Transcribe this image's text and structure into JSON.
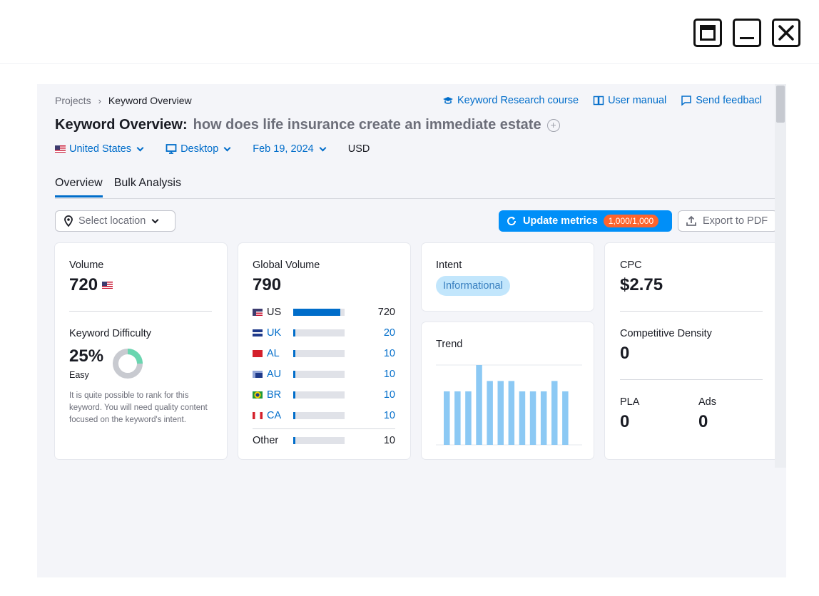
{
  "window": {
    "controls": [
      "restore-icon",
      "minimize-icon",
      "close-icon"
    ]
  },
  "breadcrumb": {
    "root": "Projects",
    "current": "Keyword Overview"
  },
  "toplinks": [
    {
      "label": "Keyword Research course",
      "icon": "graduation-cap-icon"
    },
    {
      "label": "User manual",
      "icon": "book-icon"
    },
    {
      "label": "Send feedbacl",
      "icon": "feedback-icon"
    }
  ],
  "title": {
    "prefix": "Keyword Overview:",
    "keyword": "how does life insurance create an immediate estate"
  },
  "filters": {
    "country": "United States",
    "device": "Desktop",
    "date": "Feb 19, 2024",
    "currency": "USD"
  },
  "tabs": [
    "Overview",
    "Bulk Analysis"
  ],
  "toolbar": {
    "location_placeholder": "Select location",
    "update_label": "Update metrics",
    "update_badge": "1,000/1,000",
    "export_label": "Export to PDF"
  },
  "volume_card": {
    "label": "Volume",
    "value": "720",
    "kd_label": "Keyword Difficulty",
    "kd_value": "25%",
    "kd_percent": 25,
    "kd_level": "Easy",
    "kd_text": "It is quite possible to rank for this keyword. You will need quality content focused on the keyword's intent."
  },
  "global_card": {
    "label": "Global Volume",
    "value": "790",
    "rows": [
      {
        "code": "US",
        "value": "720",
        "share": 0.91
      },
      {
        "code": "UK",
        "value": "20",
        "share": 0.03
      },
      {
        "code": "AL",
        "value": "10",
        "share": 0.03
      },
      {
        "code": "AU",
        "value": "10",
        "share": 0.03
      },
      {
        "code": "BR",
        "value": "10",
        "share": 0.03
      },
      {
        "code": "CA",
        "value": "10",
        "share": 0.03
      }
    ],
    "other": {
      "label": "Other",
      "value": "10",
      "share": 0.03
    }
  },
  "intent_card": {
    "label": "Intent",
    "badge": "Informational"
  },
  "trend_card": {
    "label": "Trend",
    "chart_data": {
      "type": "bar",
      "values": [
        0.67,
        0.67,
        0.67,
        1.0,
        0.8,
        0.8,
        0.8,
        0.67,
        0.67,
        0.67,
        0.8,
        0.67
      ],
      "ylim": [
        0,
        1
      ]
    }
  },
  "cpc_card": {
    "label": "CPC",
    "value": "$2.75",
    "cd_label": "Competitive Density",
    "cd_value": "0",
    "pla_label": "PLA",
    "pla_value": "0",
    "ads_label": "Ads",
    "ads_value": "0"
  },
  "colors": {
    "accent": "#006dca",
    "button": "#008ff8",
    "badge": "#ff642d",
    "trend_bar": "#8cc9f4",
    "kd_ring": "#6ad6b0"
  }
}
